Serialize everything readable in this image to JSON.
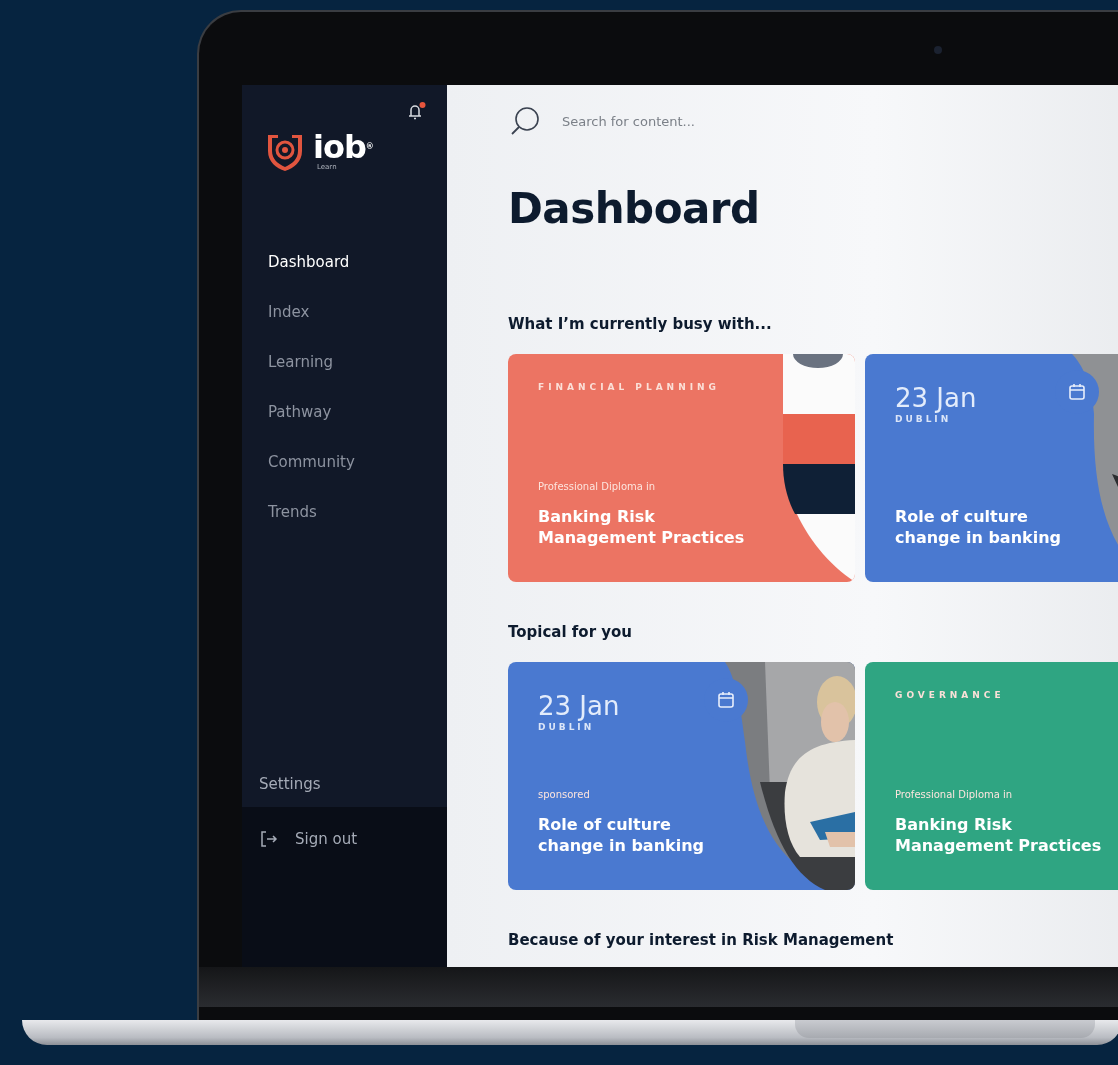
{
  "sidebar": {
    "notifications": {
      "unread": true
    },
    "logo": {
      "wordmark": "iob$^{®}$",
      "tagline": "Learn"
    },
    "nav": [
      {
        "label": "Dashboard",
        "selected": true
      },
      {
        "label": "Index",
        "selected": false
      },
      {
        "label": "Learning",
        "selected": false
      },
      {
        "label": "Pathway",
        "selected": false
      },
      {
        "label": "Community",
        "selected": false
      },
      {
        "label": "Trends",
        "selected": false
      }
    ],
    "settings": "Settings",
    "sign_out": "Sign out"
  },
  "search": {
    "placeholder": "Search for content..."
  },
  "page_title": "Dashboard",
  "sections": [
    {
      "heading": "What I’m currently busy with...",
      "cards": [
        {
          "kind": "course",
          "color": "#ec7463",
          "category": "FINANCIAL PLANNING",
          "subtitle": "Professional Diploma in",
          "title": "Banking Risk Management Practices"
        },
        {
          "kind": "event",
          "color": "#4a79d0",
          "date": "23 Jan",
          "location": "DUBLIN",
          "title": "Role of culture change in banking"
        }
      ]
    },
    {
      "heading": "Topical for you",
      "cards": [
        {
          "kind": "event",
          "color": "#4a79d0",
          "date": "23 Jan",
          "location": "DUBLIN",
          "label": "sponsored",
          "title": "Role of culture change in banking"
        },
        {
          "kind": "course",
          "color": "#2fa582",
          "category": "GOVERNANCE",
          "subtitle": "Professional Diploma in",
          "title": "Banking Risk Management Practices"
        }
      ]
    },
    {
      "heading": "Because of your interest in Risk Management"
    }
  ]
}
